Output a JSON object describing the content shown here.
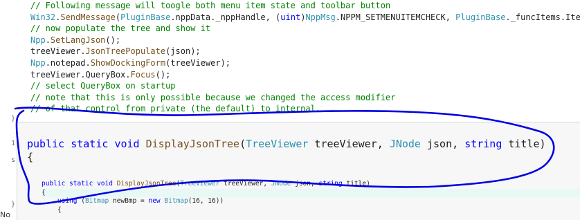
{
  "editor": {
    "code_lines": [
      {
        "segments": [
          {
            "cls": "c-comment",
            "text": "// Following message will toogle both menu item state and toolbar button"
          }
        ]
      },
      {
        "segments": [
          {
            "cls": "c-type",
            "text": "Win32"
          },
          {
            "cls": "c-plain",
            "text": "."
          },
          {
            "cls": "c-method",
            "text": "SendMessage"
          },
          {
            "cls": "c-plain",
            "text": "("
          },
          {
            "cls": "c-type",
            "text": "PluginBase"
          },
          {
            "cls": "c-plain",
            "text": ".nppData._nppHandle, ("
          },
          {
            "cls": "c-keyword",
            "text": "uint"
          },
          {
            "cls": "c-plain",
            "text": ")"
          },
          {
            "cls": "c-type",
            "text": "NppMsg"
          },
          {
            "cls": "c-plain",
            "text": ".NPPM_SETMENUITEMCHECK, "
          },
          {
            "cls": "c-type",
            "text": "PluginBase"
          },
          {
            "cls": "c-plain",
            "text": "._funcItems.Items["
          }
        ]
      },
      {
        "segments": [
          {
            "cls": "c-comment",
            "text": "// now populate the tree and show it"
          }
        ]
      },
      {
        "segments": [
          {
            "cls": "c-type",
            "text": "Npp"
          },
          {
            "cls": "c-plain",
            "text": "."
          },
          {
            "cls": "c-method",
            "text": "SetLangJson"
          },
          {
            "cls": "c-plain",
            "text": "();"
          }
        ]
      },
      {
        "segments": [
          {
            "cls": "c-plain",
            "text": "treeViewer."
          },
          {
            "cls": "c-method",
            "text": "JsonTreePopulate"
          },
          {
            "cls": "c-plain",
            "text": "(json);"
          }
        ]
      },
      {
        "segments": [
          {
            "cls": "c-type",
            "text": "Npp"
          },
          {
            "cls": "c-plain",
            "text": ".notepad."
          },
          {
            "cls": "c-method",
            "text": "ShowDockingForm"
          },
          {
            "cls": "c-plain",
            "text": "(treeViewer);"
          }
        ]
      },
      {
        "segments": [
          {
            "cls": "c-plain",
            "text": "treeViewer.QueryBox."
          },
          {
            "cls": "c-method",
            "text": "Focus"
          },
          {
            "cls": "c-plain",
            "text": "();"
          }
        ]
      },
      {
        "segments": [
          {
            "cls": "c-comment",
            "text": "// select QueryBox on startup"
          }
        ]
      },
      {
        "segments": [
          {
            "cls": "c-comment",
            "text": "// note that this is only possible because we changed the access modifier"
          }
        ]
      },
      {
        "segments": [
          {
            "cls": "c-comment",
            "text": "// of that control from private (the default) to internal."
          }
        ]
      }
    ],
    "gutter_marks": [
      "}",
      "1",
      "s",
      "}"
    ],
    "status_text": "No"
  },
  "peek": {
    "signature": {
      "kw1": "public",
      "kw2": "static",
      "kw3": "void",
      "method": "DisplayJsonTree",
      "open_paren": "(",
      "type1": "TreeViewer",
      "param1": " treeViewer, ",
      "type2": "JNode",
      "param2": " json, ",
      "kw4": "string",
      "param3": " title)",
      "brace": "{"
    },
    "inner_lines": [
      {
        "segments": [
          {
            "cls": "c-keyword",
            "text": "public static void "
          },
          {
            "cls": "c-method",
            "text": "DisplayJsonTree"
          },
          {
            "cls": "c-plain",
            "text": "("
          },
          {
            "cls": "c-type",
            "text": "TreeViewer"
          },
          {
            "cls": "c-plain",
            "text": " treeViewer, "
          },
          {
            "cls": "c-type",
            "text": "JNode"
          },
          {
            "cls": "c-plain",
            "text": " json, "
          },
          {
            "cls": "c-keyword",
            "text": "string"
          },
          {
            "cls": "c-plain",
            "text": " title)"
          }
        ]
      },
      {
        "segments": [
          {
            "cls": "c-plain",
            "text": "{"
          }
        ]
      },
      {
        "segments": [
          {
            "cls": "c-keyword",
            "text": "    using"
          },
          {
            "cls": "c-plain",
            "text": " ("
          },
          {
            "cls": "c-type",
            "text": "Bitmap"
          },
          {
            "cls": "c-plain",
            "text": " newBmp = "
          },
          {
            "cls": "c-keyword",
            "text": "new "
          },
          {
            "cls": "c-type",
            "text": "Bitmap"
          },
          {
            "cls": "c-plain",
            "text": "(16, 16))"
          }
        ]
      },
      {
        "segments": [
          {
            "cls": "c-plain",
            "text": "    {"
          }
        ]
      }
    ],
    "annotation_color": "#0000e0"
  }
}
